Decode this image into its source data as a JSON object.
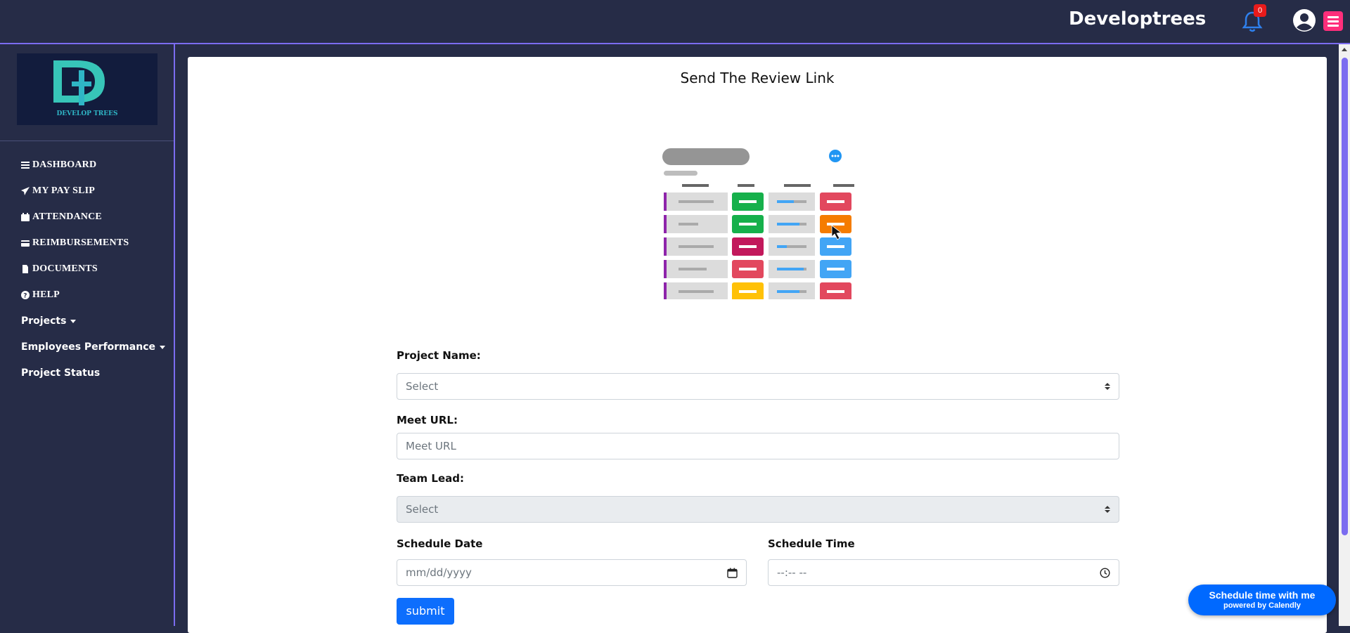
{
  "header": {
    "brand": "Developtrees",
    "notification_count": "0"
  },
  "sidebar": {
    "items": [
      {
        "label": "DASHBOARD",
        "icon": "bars-icon"
      },
      {
        "label": "MY PAY SLIP",
        "icon": "paper-plane-icon"
      },
      {
        "label": "ATTENDANCE",
        "icon": "calendar-icon"
      },
      {
        "label": "REIMBURSEMENTS",
        "icon": "credit-card-icon"
      },
      {
        "label": "DOCUMENTS",
        "icon": "file-icon"
      },
      {
        "label": "HELP",
        "icon": "question-circle-icon"
      },
      {
        "label": "Projects",
        "icon": "caret-down-icon"
      },
      {
        "label": "Employees Performance",
        "icon": "caret-down-icon"
      },
      {
        "label": "Project Status",
        "icon": ""
      }
    ]
  },
  "main": {
    "title": "Send The Review Link",
    "form": {
      "project_name_label": "Project Name:",
      "project_name_value": "Select",
      "meet_url_label": "Meet URL:",
      "meet_url_placeholder": "Meet URL",
      "team_lead_label": "Team Lead:",
      "team_lead_value": "Select",
      "schedule_date_label": "Schedule Date",
      "schedule_date_placeholder": "mm/dd/yyyy",
      "schedule_time_label": "Schedule Time",
      "schedule_time_placeholder": "--:-- --",
      "submit_label": "submit"
    }
  },
  "calendly": {
    "line1": "Schedule time with me",
    "line2": "powered by Calendly"
  },
  "colors": {
    "background": "#262c47",
    "accent": "#7b6cf0",
    "primary_button": "#0d6efd",
    "menu_button": "#ff2e7b",
    "calendly": "#0069ff"
  }
}
